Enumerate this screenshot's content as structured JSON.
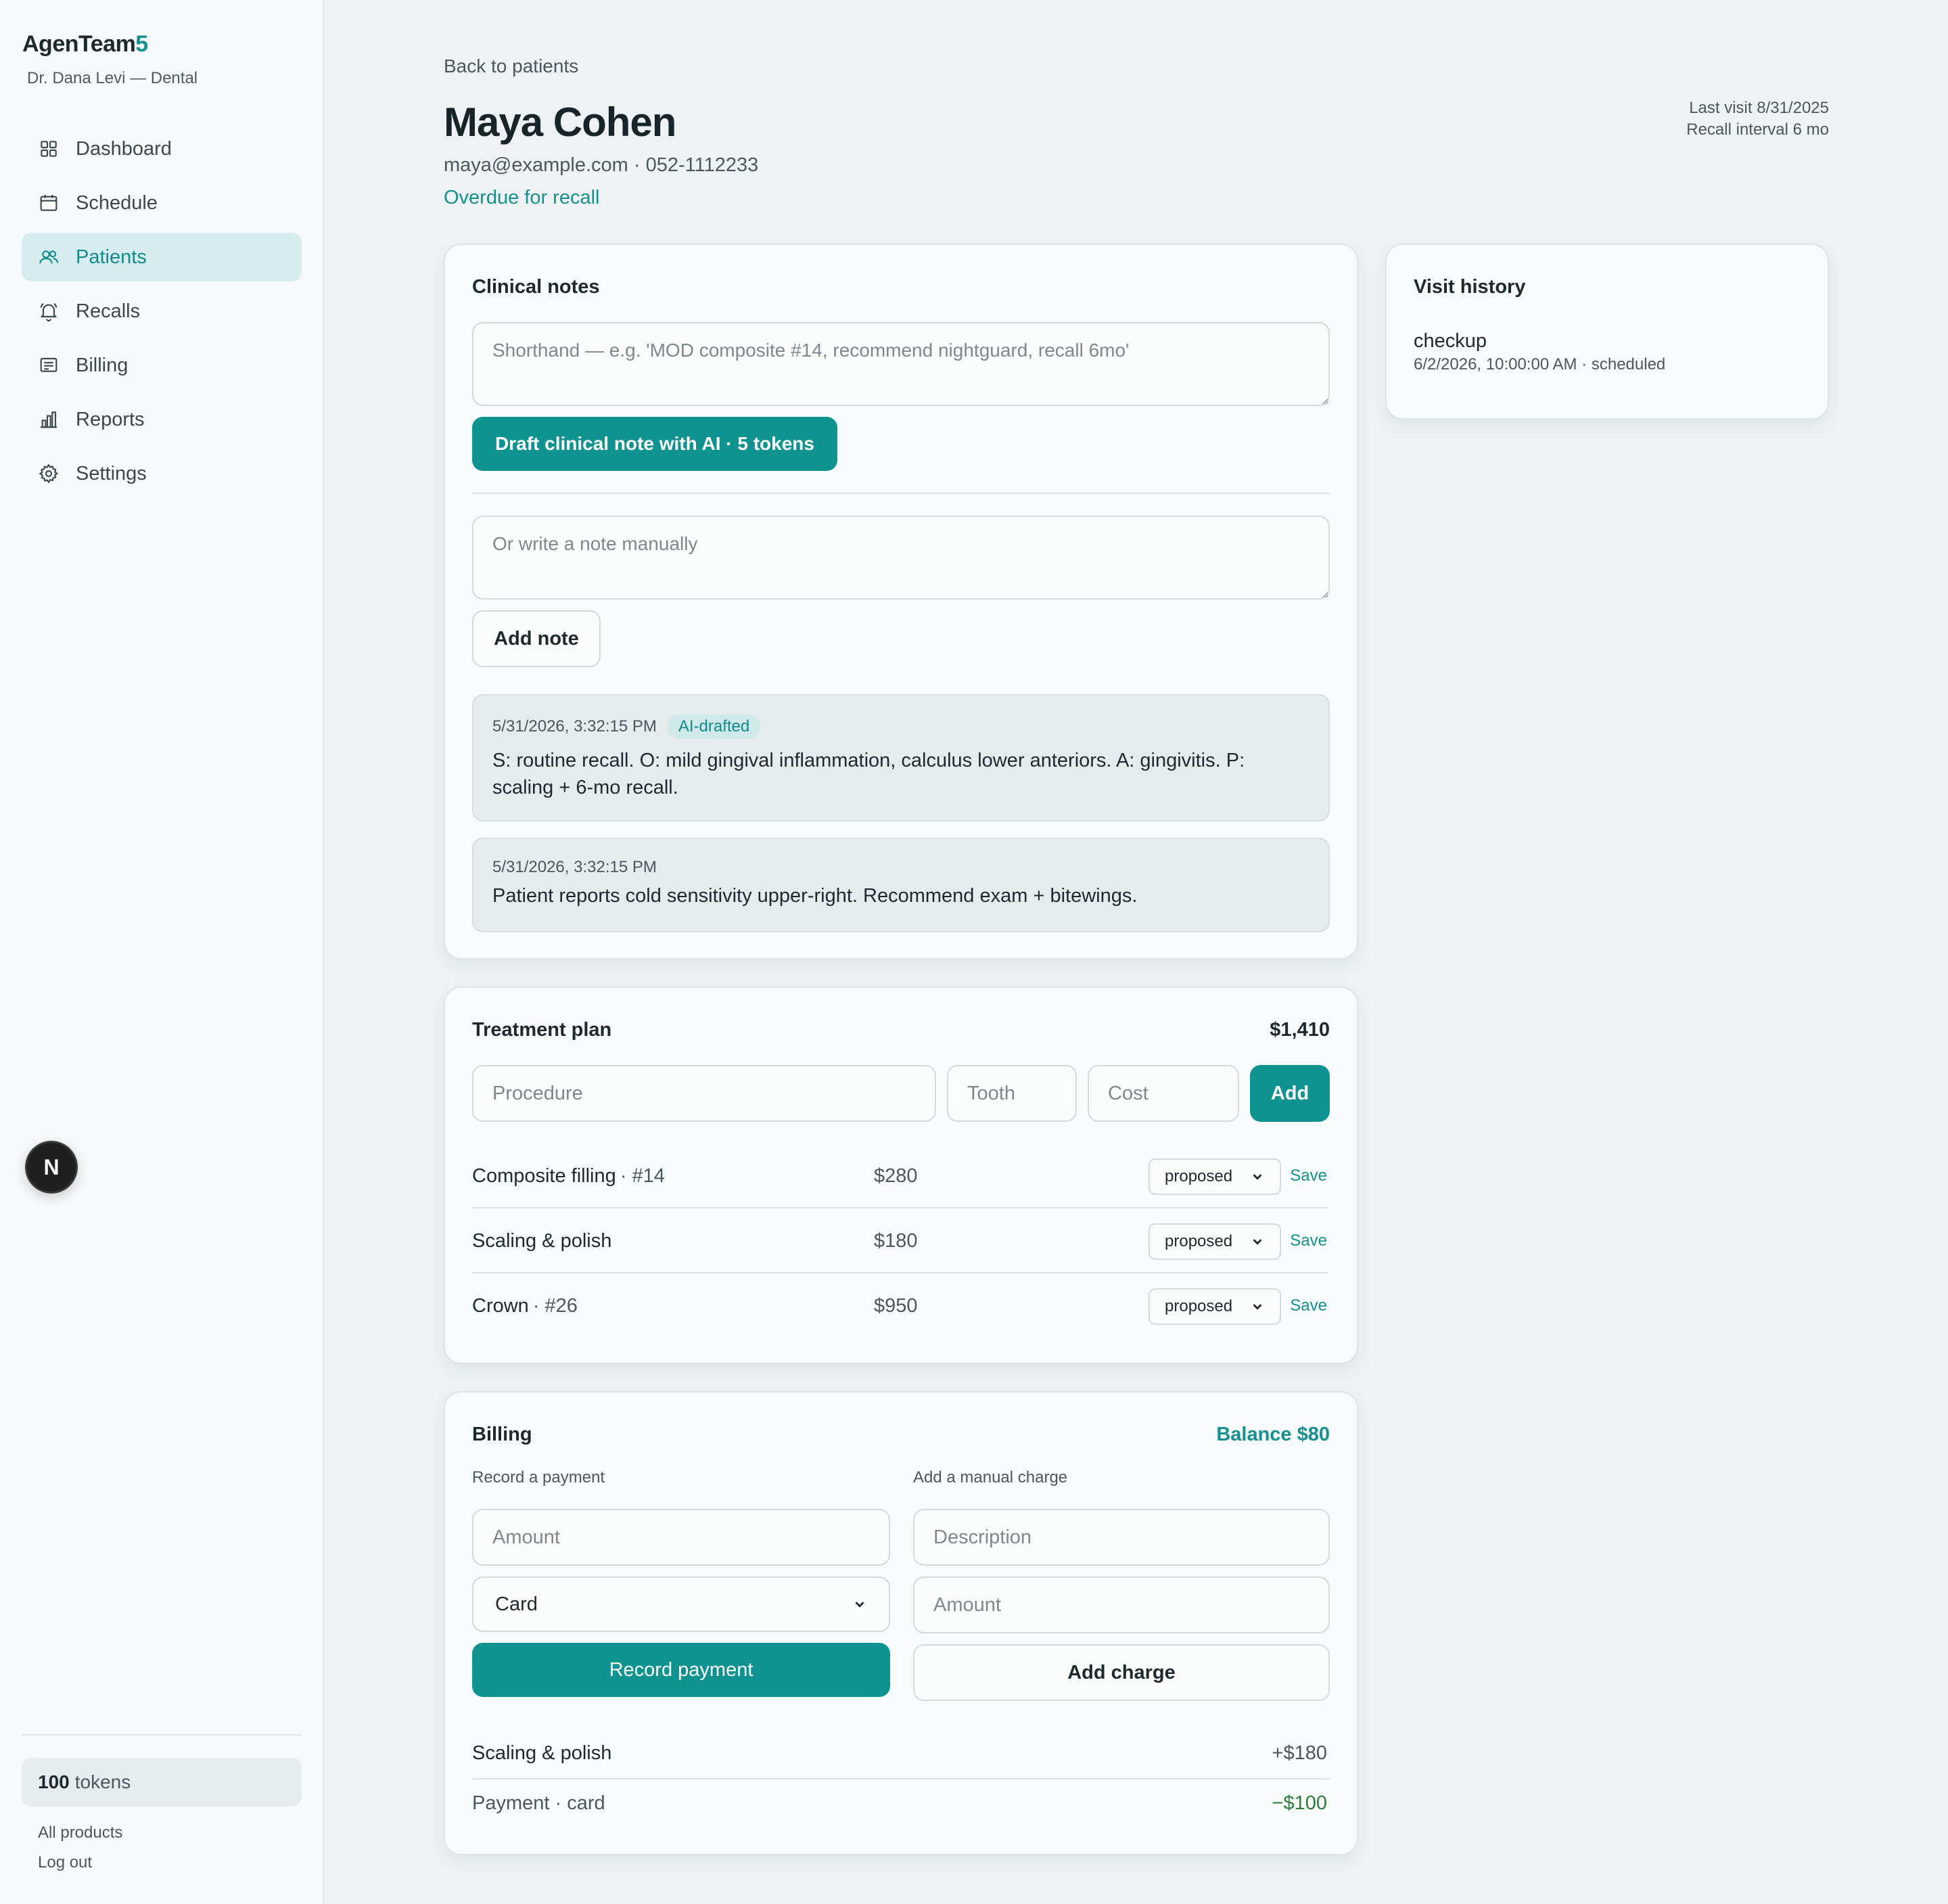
{
  "sidebar": {
    "brand_main": "AgenTeam",
    "brand_accent": "5",
    "subtitle": "Dr. Dana Levi — Dental",
    "items": [
      {
        "label": "Dashboard",
        "icon": "grid-icon"
      },
      {
        "label": "Schedule",
        "icon": "calendar-icon"
      },
      {
        "label": "Patients",
        "icon": "users-icon",
        "active": true
      },
      {
        "label": "Recalls",
        "icon": "bell-icon"
      },
      {
        "label": "Billing",
        "icon": "receipt-icon"
      },
      {
        "label": "Reports",
        "icon": "bar-chart-icon"
      },
      {
        "label": "Settings",
        "icon": "gear-icon"
      }
    ],
    "tokens_count": "100",
    "tokens_label": "tokens",
    "all_products": "All products",
    "logout": "Log out",
    "fab_letter": "N"
  },
  "header": {
    "back": "Back to patients",
    "name": "Maya Cohen",
    "contact": "maya@example.com · 052-1112233",
    "status": "Overdue for recall",
    "last_visit": "Last visit 8/31/2025",
    "recall_interval": "Recall interval 6 mo"
  },
  "clinical_notes": {
    "title": "Clinical notes",
    "shorthand_placeholder": "Shorthand — e.g. 'MOD composite #14, recommend nightguard, recall 6mo'",
    "draft_button": "Draft clinical note with AI · 5 tokens",
    "manual_placeholder": "Or write a note manually",
    "add_note_button": "Add note",
    "notes": [
      {
        "timestamp": "5/31/2026, 3:32:15 PM",
        "badge": "AI-drafted",
        "body": "S: routine recall. O: mild gingival inflammation, calculus lower anteriors. A: gingivitis. P: scaling + 6-mo recall."
      },
      {
        "timestamp": "5/31/2026, 3:32:15 PM",
        "badge": "",
        "body": "Patient reports cold sensitivity upper-right. Recommend exam + bitewings."
      }
    ]
  },
  "visit_history": {
    "title": "Visit history",
    "visits": [
      {
        "type": "checkup",
        "detail": "6/2/2026, 10:00:00 AM · scheduled"
      }
    ]
  },
  "treatment_plan": {
    "title": "Treatment plan",
    "total": "$1,410",
    "procedure_placeholder": "Procedure",
    "tooth_placeholder": "Tooth",
    "cost_placeholder": "Cost",
    "add_button": "Add",
    "save_label": "Save",
    "rows": [
      {
        "procedure": "Composite filling",
        "tooth": "· #14",
        "cost": "$280",
        "status": "proposed"
      },
      {
        "procedure": "Scaling & polish",
        "tooth": "",
        "cost": "$180",
        "status": "proposed"
      },
      {
        "procedure": "Crown",
        "tooth": "· #26",
        "cost": "$950",
        "status": "proposed"
      }
    ]
  },
  "billing": {
    "title": "Billing",
    "balance": "Balance $80",
    "payment_label": "Record a payment",
    "charge_label": "Add a manual charge",
    "amount_placeholder": "Amount",
    "method_selected": "Card",
    "record_button": "Record payment",
    "description_placeholder": "Description",
    "charge_amount_placeholder": "Amount",
    "add_charge_button": "Add charge",
    "ledger": [
      {
        "label": "Scaling & polish",
        "amount": "+$180",
        "kind": "charge"
      },
      {
        "label": "Payment · card",
        "amount": "−$100",
        "kind": "payment"
      }
    ]
  },
  "colors": {
    "accent": "#0f9390",
    "background": "#eef2f4",
    "payment_green": "#2f7d3a"
  }
}
